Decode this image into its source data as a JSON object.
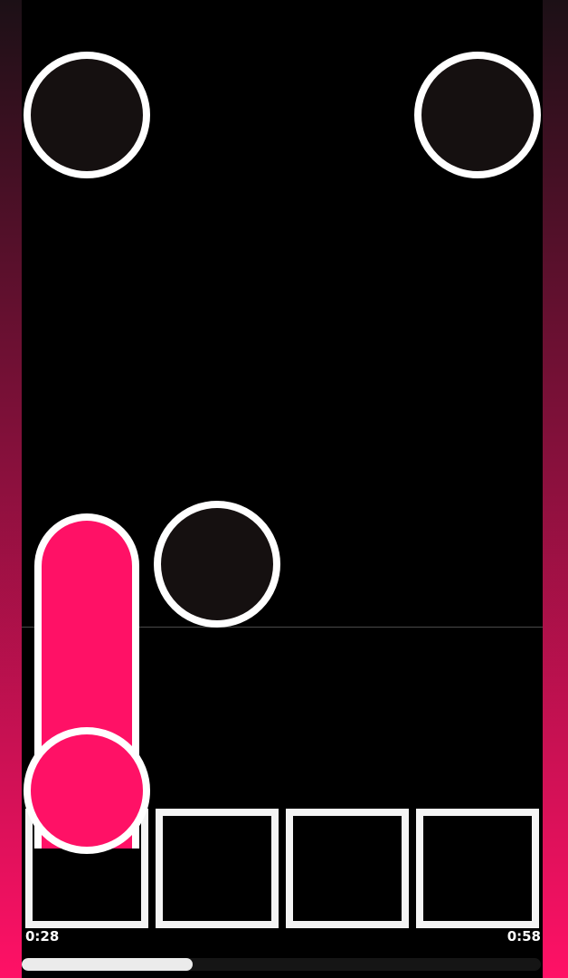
{
  "game": {
    "elapsed_time": "0:28",
    "total_time": "0:58",
    "progress": 0.33,
    "lanes": 4,
    "colors": {
      "background": "#000000",
      "accent": "#ff1166",
      "note_fill": "#151010",
      "note_outline": "#ffffff",
      "side_gradient_top": "#1c1016",
      "side_gradient_bottom": "#ff1166"
    },
    "notes": [
      {
        "type": "tap",
        "lane": 1,
        "state": "falling"
      },
      {
        "type": "tap",
        "lane": 4,
        "state": "falling"
      },
      {
        "type": "tap",
        "lane": 2,
        "state": "falling"
      },
      {
        "type": "hold",
        "lane": 1,
        "state": "holding"
      }
    ]
  }
}
